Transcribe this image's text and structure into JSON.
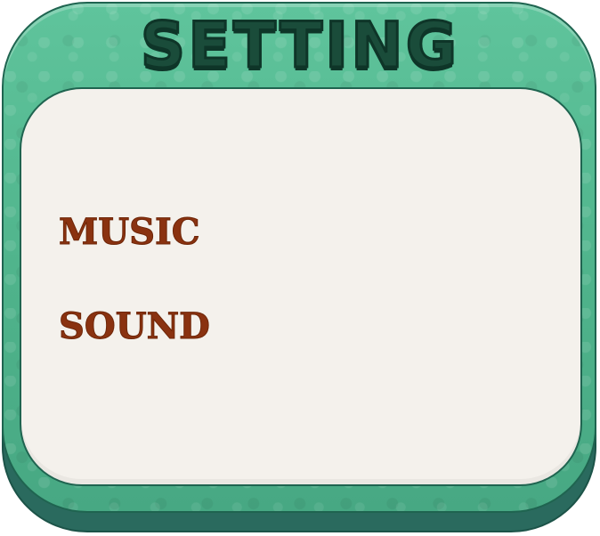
{
  "dialog": {
    "title": "SETTING",
    "options": [
      {
        "label": "MUSIC"
      },
      {
        "label": "SOUND"
      }
    ]
  },
  "colors": {
    "frame": "#52b890",
    "frame_shadow": "#2a6a5e",
    "panel": "#f4f1ec",
    "title_text": "#1a4c3a",
    "label_text": "#8a3210"
  }
}
